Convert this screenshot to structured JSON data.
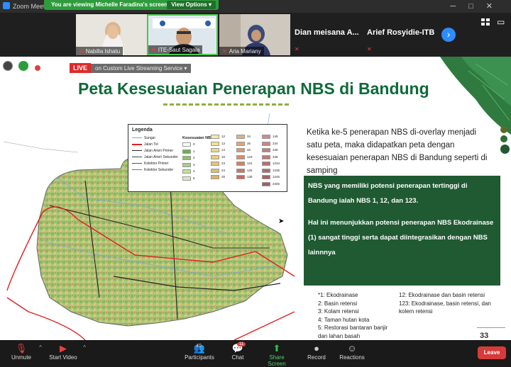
{
  "window": {
    "app_name": "Zoom Meeti"
  },
  "banner": {
    "viewing_text": "You are viewing Michelle Faradina's screen",
    "view_options": "View Options"
  },
  "participants": [
    {
      "name": "Nabilla Ishatu"
    },
    {
      "name": "ITE-Saut Sagala"
    },
    {
      "name": "Aria Mariany"
    },
    {
      "name": "Dian meisana A..."
    },
    {
      "name": "Arief Rosyidie-ITB"
    }
  ],
  "live": {
    "label": "LIVE",
    "service": "on Custom Live Streaming Service"
  },
  "slide": {
    "title": "Peta Kesesuaian Penerapan NBS di Bandung",
    "paragraph": "Ketika ke-5 penerapan NBS di-overlay menjadi satu peta, maka didapatkan peta dengan kesesuaian penerapan NBS di Bandung seperti di samping",
    "greenbox_p1": "NBS yang memiliki potensi penerapan tertinggi di Bandung ialah NBS 1, 12, dan 123.",
    "greenbox_p2": "Hal ini menunjukkan potensi penerapan NBS Ekodrainase (1) sangat tinggi serta dapat diintegrasikan dengan NBS lainnnya",
    "notes_col1": [
      "*1: Ekodrainase",
      "2: Basin retensi",
      "3: Kolam retensi",
      "4: Taman hutan kota",
      "5: Restorasi bantaran banjir dan lahan basah"
    ],
    "notes_col2": [
      "12: Ekodrainase dan basin retensi",
      "123: Ekodrainase, basin retensi, dan kolem retensi"
    ],
    "page_number": "33"
  },
  "legend": {
    "title": "Legenda",
    "header": "Kesesuaian NBS",
    "lines": [
      "Sungai",
      "Jalan Tol",
      "Jalan Arteri Primer",
      "Jalan Arteri Sekunder",
      "Kolektor Primer",
      "Kolektor Sekunder"
    ],
    "line_colors": [
      "#7aa6d9",
      "#e02020",
      "#222222",
      "#444444",
      "#555555",
      "#777777"
    ],
    "classes_col1": [
      "0",
      "1",
      "2",
      "3",
      "4",
      "5"
    ],
    "classes_col2": [
      "12",
      "13",
      "14",
      "15",
      "23",
      "24",
      "25"
    ],
    "classes_col3": [
      "34",
      "35",
      "45",
      "123",
      "124",
      "125",
      "135"
    ],
    "classes_col4": [
      "145",
      "234",
      "235",
      "345",
      "1234",
      "1235",
      "1245",
      "2345"
    ],
    "colors_col1": [
      "#ffffff",
      "#6fae4f",
      "#8fc06a",
      "#a9cf84",
      "#c4de9f",
      "#dbe9b8"
    ],
    "colors_col2": [
      "#f3e9a6",
      "#f0e09a",
      "#ecd68e",
      "#e9cd84",
      "#e6c47a",
      "#e2bb70",
      "#dfb267"
    ],
    "colors_col3": [
      "#e4b07e",
      "#e0a477",
      "#dc9870",
      "#d88c6a",
      "#d48064",
      "#d0745e",
      "#cc6858"
    ],
    "colors_col4": [
      "#cf8b8b",
      "#c98585",
      "#c27e7e",
      "#bc7878",
      "#b57171",
      "#af6b6b",
      "#a86464",
      "#a25e5e"
    ]
  },
  "toolbar": {
    "unmute": "Unmute",
    "start_video": "Start Video",
    "participants": "Participants",
    "participants_count": "40",
    "chat": "Chat",
    "chat_badge": "11",
    "share_screen": "Share Screen",
    "record": "Record",
    "reactions": "Reactions",
    "leave": "Leave"
  },
  "colors": {
    "slide_green": "#0f6a3a",
    "box_green": "#1f5a32",
    "zoom_blue": "#2d8cff",
    "leave_red": "#d83a3a",
    "live_red": "#e02a2a"
  }
}
